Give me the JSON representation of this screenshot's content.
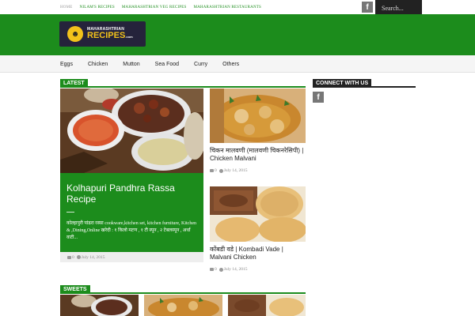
{
  "topnav": {
    "items": [
      "Home",
      "Nilam's Recipes",
      "Maharashtrian Veg Recipes",
      "Maharashtrian Restaurants"
    ]
  },
  "search": {
    "placeholder": "Search..."
  },
  "facebook_icon": "f",
  "logo": {
    "line1": "MAHARASHTRIAN",
    "line2": "RECIPES",
    "suffix": ".com"
  },
  "mainnav": {
    "items": [
      "Eggs",
      "Chicken",
      "Mutton",
      "Sea Food",
      "Curry",
      "Others"
    ]
  },
  "sections": {
    "latest": "Latest",
    "connect": "Connect With Us",
    "sweets": "Sweets"
  },
  "featured": {
    "title": "Kolhapuri Pandhra Rassa Recipe",
    "excerpt": "कोल्हापुरी पांढरा रस्सा cookware,kitchen set, kitchen furniture, Kitchen & ,Dining,Online खरेदी : १ किलो मटण , १ टी स्पून , २ टेबलस्पून , अर्धा वाटी...",
    "comments": "0",
    "date": "July 14, 2015"
  },
  "posts": [
    {
      "title": "चिकन मालवणी (मालवणी चिकनरेसिपी) | Chicken Malvani",
      "comments": "0",
      "date": "July 14, 2015"
    },
    {
      "title": "कोंबडी वडे | Kombadi Vade | Malvani Chicken",
      "comments": "0",
      "date": "July 14, 2015"
    }
  ],
  "colors": {
    "brand": "#1c8c1c",
    "dark": "#222222",
    "logo_bg": "#25233b",
    "logo_accent": "#f2c21b"
  }
}
